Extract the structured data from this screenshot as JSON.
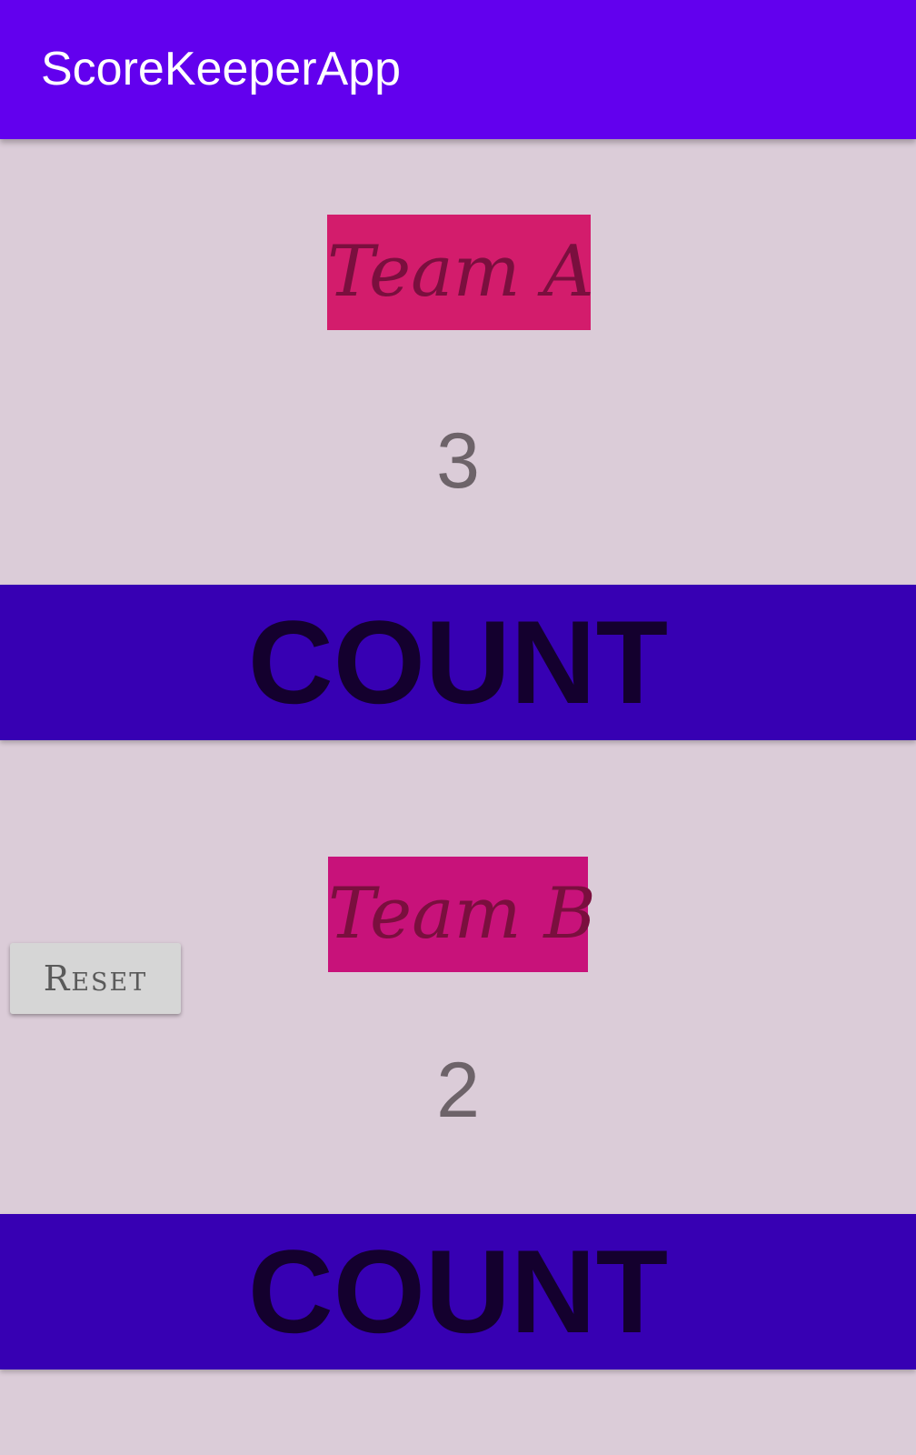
{
  "app_bar": {
    "title": "ScoreKeeperApp",
    "background_color": "#6200EE"
  },
  "team_a": {
    "label": "Team A",
    "label_background": "#D31C6C",
    "score": "3",
    "count_button_label": "COUNT"
  },
  "team_b": {
    "label": "Team B",
    "label_background": "#C8127A",
    "score": "2",
    "count_button_label": "COUNT"
  },
  "reset_button": {
    "label": "Reset"
  },
  "colors": {
    "page_background": "#DBCCD8",
    "count_button_background": "#3700B3"
  }
}
